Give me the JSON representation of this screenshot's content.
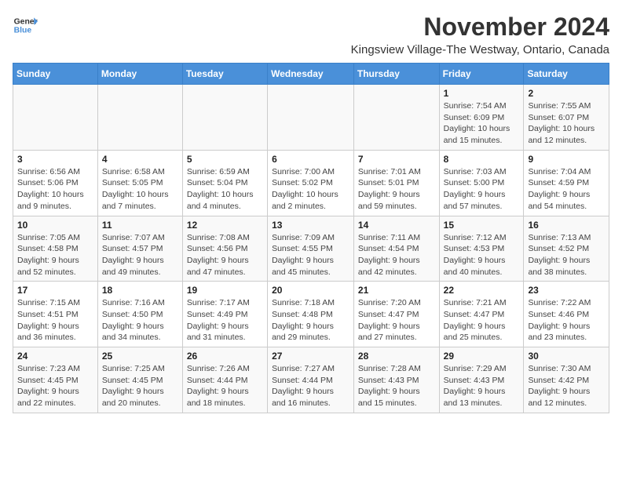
{
  "header": {
    "logo_line1": "General",
    "logo_line2": "Blue",
    "title": "November 2024",
    "subtitle": "Kingsview Village-The Westway, Ontario, Canada"
  },
  "weekdays": [
    "Sunday",
    "Monday",
    "Tuesday",
    "Wednesday",
    "Thursday",
    "Friday",
    "Saturday"
  ],
  "weeks": [
    [
      {
        "day": "",
        "info": ""
      },
      {
        "day": "",
        "info": ""
      },
      {
        "day": "",
        "info": ""
      },
      {
        "day": "",
        "info": ""
      },
      {
        "day": "",
        "info": ""
      },
      {
        "day": "1",
        "info": "Sunrise: 7:54 AM\nSunset: 6:09 PM\nDaylight: 10 hours and 15 minutes."
      },
      {
        "day": "2",
        "info": "Sunrise: 7:55 AM\nSunset: 6:07 PM\nDaylight: 10 hours and 12 minutes."
      }
    ],
    [
      {
        "day": "3",
        "info": "Sunrise: 6:56 AM\nSunset: 5:06 PM\nDaylight: 10 hours and 9 minutes."
      },
      {
        "day": "4",
        "info": "Sunrise: 6:58 AM\nSunset: 5:05 PM\nDaylight: 10 hours and 7 minutes."
      },
      {
        "day": "5",
        "info": "Sunrise: 6:59 AM\nSunset: 5:04 PM\nDaylight: 10 hours and 4 minutes."
      },
      {
        "day": "6",
        "info": "Sunrise: 7:00 AM\nSunset: 5:02 PM\nDaylight: 10 hours and 2 minutes."
      },
      {
        "day": "7",
        "info": "Sunrise: 7:01 AM\nSunset: 5:01 PM\nDaylight: 9 hours and 59 minutes."
      },
      {
        "day": "8",
        "info": "Sunrise: 7:03 AM\nSunset: 5:00 PM\nDaylight: 9 hours and 57 minutes."
      },
      {
        "day": "9",
        "info": "Sunrise: 7:04 AM\nSunset: 4:59 PM\nDaylight: 9 hours and 54 minutes."
      }
    ],
    [
      {
        "day": "10",
        "info": "Sunrise: 7:05 AM\nSunset: 4:58 PM\nDaylight: 9 hours and 52 minutes."
      },
      {
        "day": "11",
        "info": "Sunrise: 7:07 AM\nSunset: 4:57 PM\nDaylight: 9 hours and 49 minutes."
      },
      {
        "day": "12",
        "info": "Sunrise: 7:08 AM\nSunset: 4:56 PM\nDaylight: 9 hours and 47 minutes."
      },
      {
        "day": "13",
        "info": "Sunrise: 7:09 AM\nSunset: 4:55 PM\nDaylight: 9 hours and 45 minutes."
      },
      {
        "day": "14",
        "info": "Sunrise: 7:11 AM\nSunset: 4:54 PM\nDaylight: 9 hours and 42 minutes."
      },
      {
        "day": "15",
        "info": "Sunrise: 7:12 AM\nSunset: 4:53 PM\nDaylight: 9 hours and 40 minutes."
      },
      {
        "day": "16",
        "info": "Sunrise: 7:13 AM\nSunset: 4:52 PM\nDaylight: 9 hours and 38 minutes."
      }
    ],
    [
      {
        "day": "17",
        "info": "Sunrise: 7:15 AM\nSunset: 4:51 PM\nDaylight: 9 hours and 36 minutes."
      },
      {
        "day": "18",
        "info": "Sunrise: 7:16 AM\nSunset: 4:50 PM\nDaylight: 9 hours and 34 minutes."
      },
      {
        "day": "19",
        "info": "Sunrise: 7:17 AM\nSunset: 4:49 PM\nDaylight: 9 hours and 31 minutes."
      },
      {
        "day": "20",
        "info": "Sunrise: 7:18 AM\nSunset: 4:48 PM\nDaylight: 9 hours and 29 minutes."
      },
      {
        "day": "21",
        "info": "Sunrise: 7:20 AM\nSunset: 4:47 PM\nDaylight: 9 hours and 27 minutes."
      },
      {
        "day": "22",
        "info": "Sunrise: 7:21 AM\nSunset: 4:47 PM\nDaylight: 9 hours and 25 minutes."
      },
      {
        "day": "23",
        "info": "Sunrise: 7:22 AM\nSunset: 4:46 PM\nDaylight: 9 hours and 23 minutes."
      }
    ],
    [
      {
        "day": "24",
        "info": "Sunrise: 7:23 AM\nSunset: 4:45 PM\nDaylight: 9 hours and 22 minutes."
      },
      {
        "day": "25",
        "info": "Sunrise: 7:25 AM\nSunset: 4:45 PM\nDaylight: 9 hours and 20 minutes."
      },
      {
        "day": "26",
        "info": "Sunrise: 7:26 AM\nSunset: 4:44 PM\nDaylight: 9 hours and 18 minutes."
      },
      {
        "day": "27",
        "info": "Sunrise: 7:27 AM\nSunset: 4:44 PM\nDaylight: 9 hours and 16 minutes."
      },
      {
        "day": "28",
        "info": "Sunrise: 7:28 AM\nSunset: 4:43 PM\nDaylight: 9 hours and 15 minutes."
      },
      {
        "day": "29",
        "info": "Sunrise: 7:29 AM\nSunset: 4:43 PM\nDaylight: 9 hours and 13 minutes."
      },
      {
        "day": "30",
        "info": "Sunrise: 7:30 AM\nSunset: 4:42 PM\nDaylight: 9 hours and 12 minutes."
      }
    ]
  ]
}
